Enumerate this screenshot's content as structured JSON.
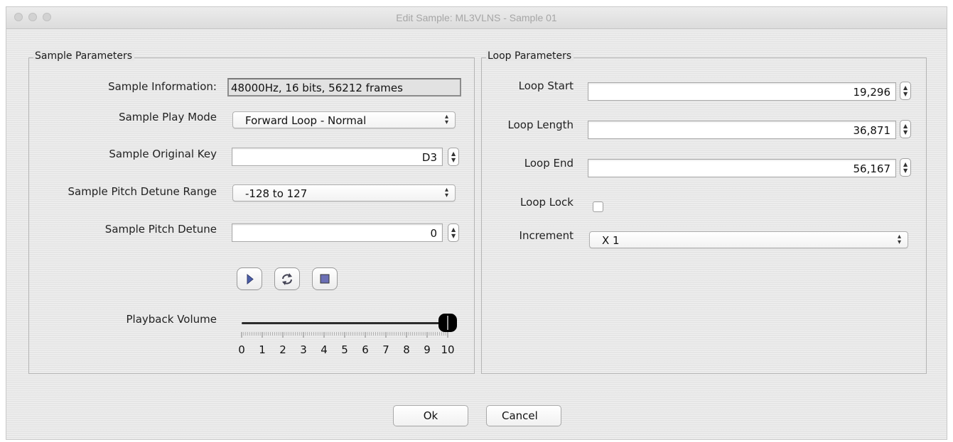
{
  "window": {
    "title": "Edit Sample: ML3VLNS - Sample 01"
  },
  "sample": {
    "group_title": "Sample Parameters",
    "info_label": "Sample Information:",
    "info_value": "48000Hz, 16 bits, 56212 frames",
    "play_mode_label": "Sample Play Mode",
    "play_mode_value": "Forward Loop - Normal",
    "original_key_label": "Sample Original Key",
    "original_key_value": "D3",
    "detune_range_label": "Sample Pitch Detune Range",
    "detune_range_value": "-128 to 127",
    "detune_label": "Sample Pitch Detune",
    "detune_value": "0",
    "volume_label": "Playback Volume",
    "volume_value": 10,
    "volume_ticks": [
      "0",
      "1",
      "2",
      "3",
      "4",
      "5",
      "6",
      "7",
      "8",
      "9",
      "10"
    ]
  },
  "loop": {
    "group_title": "Loop Parameters",
    "start_label": "Loop Start",
    "start_value": "19,296",
    "length_label": "Loop Length",
    "length_value": "36,871",
    "end_label": "Loop End",
    "end_value": "56,167",
    "lock_label": "Loop Lock",
    "lock_checked": false,
    "increment_label": "Increment",
    "increment_value": "X 1"
  },
  "buttons": {
    "ok": "Ok",
    "cancel": "Cancel"
  },
  "icons": {
    "play": "play-icon",
    "loop": "loop-play-icon",
    "stop": "stop-icon"
  }
}
